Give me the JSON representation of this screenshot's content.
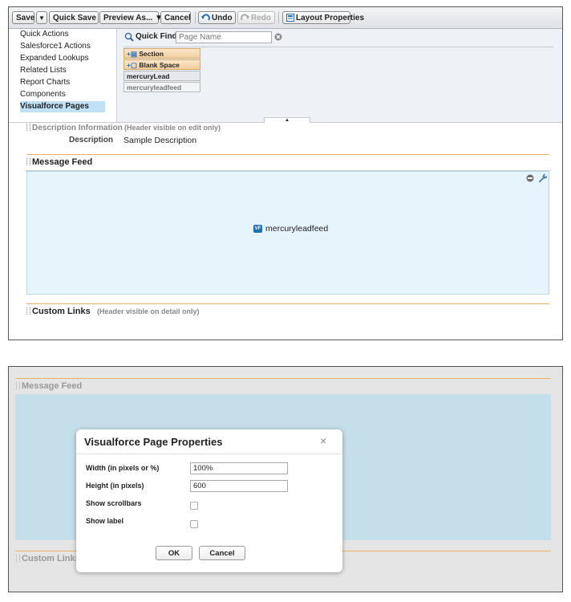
{
  "toolbar": {
    "save": "Save",
    "save_dropdown": "▼",
    "quick_save": "Quick Save",
    "preview_as": "Preview As... ▼",
    "cancel": "Cancel",
    "undo": "Undo",
    "redo": "Redo",
    "layout_properties": "Layout Properties"
  },
  "palette": {
    "categories": [
      {
        "label": "Quick Actions"
      },
      {
        "label": "Salesforce1 Actions"
      },
      {
        "label": "Expanded Lookups"
      },
      {
        "label": "Related Lists"
      },
      {
        "label": "Report Charts"
      },
      {
        "label": "Components"
      },
      {
        "label": "Visualforce Pages"
      }
    ],
    "quick_find_label": "Quick Find",
    "quick_find_placeholder": "Page Name",
    "items": [
      {
        "label": "Section"
      },
      {
        "label": "Blank Space"
      },
      {
        "label": "mercuryLead"
      },
      {
        "label": "mercuryleadfeed"
      }
    ]
  },
  "layout": {
    "description_section": "Description Information",
    "description_note": "(Header visible on edit only)",
    "description_field_label": "Description",
    "description_field_value": "Sample Description",
    "message_feed_section": "Message Feed",
    "vf_badge": "VF",
    "vf_page_name": "mercuryleadfeed",
    "custom_links_section": "Custom Links",
    "custom_links_note": "(Header visible on detail only)"
  },
  "bottom": {
    "message_feed_section": "Message Feed",
    "custom_links_section": "Custom Links"
  },
  "modal": {
    "title": "Visualforce Page Properties",
    "close": "×",
    "width_label": "Width (in pixels or %)",
    "width_value": "100%",
    "height_label": "Height (in pixels)",
    "height_value": "600",
    "scrollbars_label": "Show scrollbars",
    "show_label_label": "Show label",
    "ok": "OK",
    "cancel": "Cancel"
  },
  "colors": {
    "accent_orange": "#e7b266",
    "canvas_blue": "#e6f4fc",
    "overlay_blue": "#c4dfe9",
    "selected_category": "#bfe0f5"
  }
}
